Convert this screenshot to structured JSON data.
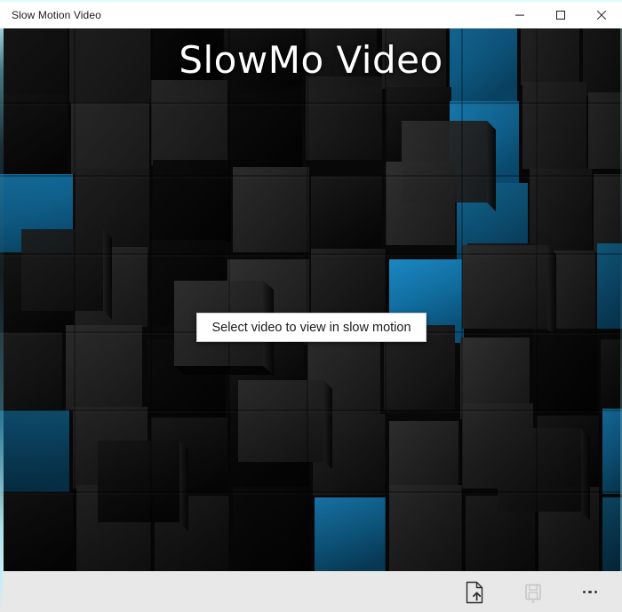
{
  "window": {
    "title": "Slow Motion Video",
    "controls": [
      {
        "name": "minimize",
        "label": "–",
        "tooltip": "Minimize"
      },
      {
        "name": "maximize",
        "label": "☐",
        "tooltip": "Maximize"
      },
      {
        "name": "close",
        "label": "✕",
        "tooltip": "Close"
      }
    ]
  },
  "app": {
    "heading": "SlowMo Video"
  },
  "stage": {
    "select_button_label": "Select video to view in slow motion"
  },
  "command_bar": {
    "items": [
      {
        "name": "open-file",
        "icon": "file-upload-icon",
        "label": "Open video file",
        "enabled": true
      },
      {
        "name": "save-file",
        "icon": "save-icon",
        "label": "Save",
        "enabled": false
      },
      {
        "name": "more",
        "icon": "ellipsis-icon",
        "label": "See more",
        "enabled": true
      }
    ]
  },
  "colors": {
    "accent_blue": "#106a9c",
    "accent_blue_light": "#1b82bd",
    "cube_dark": "#1e1e1e",
    "cube_darker": "#101010",
    "cube_black": "#070707",
    "command_bar_bg": "#e8e8e8",
    "titlebar_bg": "#ffffff",
    "titlebar_accent": "#dcfbff",
    "button_bg": "#ffffff",
    "button_text": "#1b1b1b",
    "heading_text": "#ffffff"
  }
}
